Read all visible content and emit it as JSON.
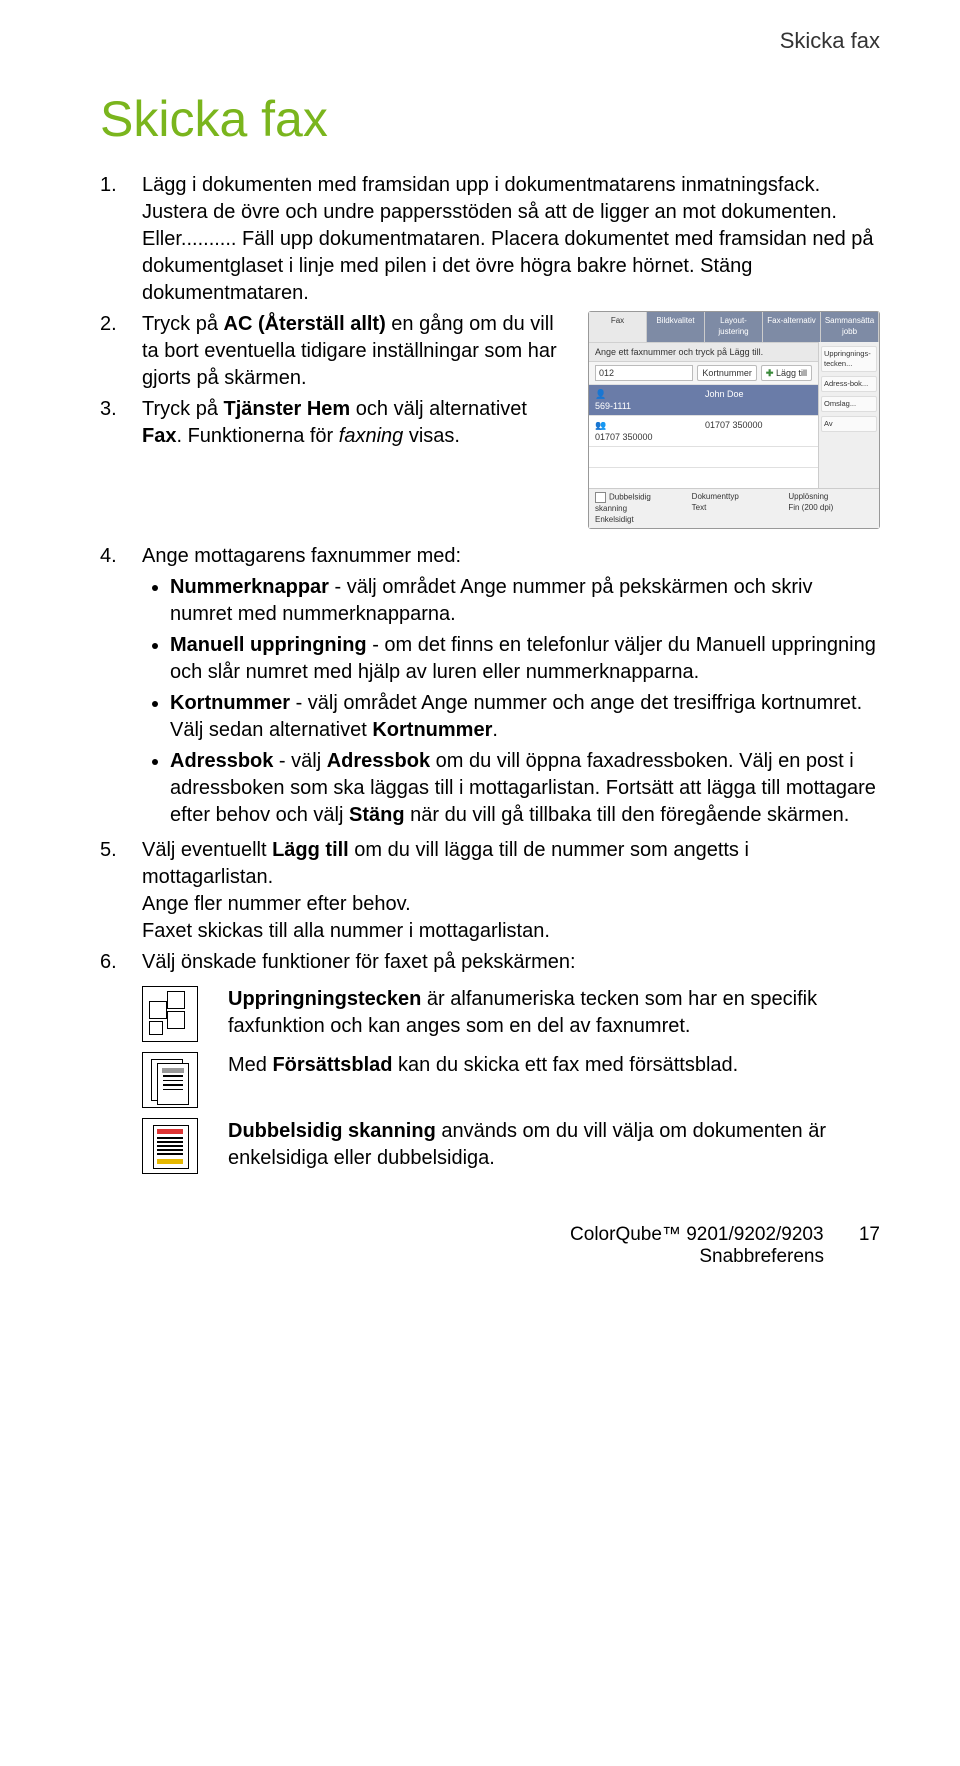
{
  "header": {
    "section": "Skicka fax"
  },
  "title": "Skicka fax",
  "steps": {
    "s1": "Lägg i dokumenten med framsidan upp i dokumentmatarens inmatningsfack. Justera de övre och undre pappersstöden så att de ligger an mot dokumenten. Eller.......... Fäll upp dokumentmataren. Placera dokumentet med framsidan ned på dokumentglaset i linje med pilen i det övre högra bakre hörnet. Stäng dokumentmataren.",
    "s2_a": "Tryck på ",
    "s2_b": "AC (Återställ allt)",
    "s2_c": " en gång om du vill ta bort eventuella tidigare inställningar som har gjorts på skärmen.",
    "s3_a": "Tryck på ",
    "s3_b": "Tjänster Hem",
    "s3_c": "  och välj alternativet ",
    "s3_d": "Fax",
    "s3_e": ". Funktionerna för ",
    "s3_f": "faxning",
    "s3_g": " visas.",
    "s4": "Ange mottagarens faxnummer med:",
    "b1_a": "Nummerknappar",
    "b1_b": " - välj området Ange nummer på pekskärmen och skriv numret med nummerknapparna.",
    "b2_a": "Manuell uppringning",
    "b2_b": " - om det finns en telefonlur väljer du Manuell uppringning och slår numret med hjälp av luren eller nummerknapparna.",
    "b3_a": "Kortnummer",
    "b3_b": " - välj området Ange nummer och ange det tresiffriga kortnumret. Välj sedan alternativet ",
    "b3_c": "Kortnummer",
    "b3_d": ".",
    "b4_a": "Adressbok",
    "b4_b": " - välj ",
    "b4_c": "Adressbok",
    "b4_d": " om du vill öppna faxadressboken. Välj en post i adressboken som ska läggas till i mottagarlistan. Fortsätt att lägga till mottagare efter behov och välj ",
    "b4_e": "Stäng",
    "b4_f": " när du vill gå tillbaka till den föregående skärmen.",
    "s5_a": "Välj eventuellt ",
    "s5_b": "Lägg till",
    "s5_c": " om du vill lägga till de nummer som angetts i mottagarlistan.",
    "s5_d": "Ange fler nummer efter behov.",
    "s5_e": "Faxet skickas till alla nummer i mottagarlistan.",
    "s6": "Välj önskade funktioner för faxet på pekskärmen:",
    "ic1_a": "Uppringningstecken",
    "ic1_b": " är alfanumeriska tecken som har en specifik faxfunktion och kan anges som en del av faxnumret.",
    "ic2_a": "Med ",
    "ic2_b": "Försättsblad",
    "ic2_c": " kan du skicka ett fax med försättsblad.",
    "ic3_a": "Dubbelsidig skanning",
    "ic3_b": " används om du vill välja om dokumenten är enkelsidiga eller dubbelsidiga."
  },
  "shot": {
    "tabs": [
      "Fax",
      "Bildkvalitet",
      "Layout-justering",
      "Fax-alternativ",
      "Sammansätta jobb"
    ],
    "instruction": "Ange ett faxnummer och tryck på Lägg till.",
    "input_val": "012",
    "kort": "Kortnummer",
    "lagg": "Lägg till",
    "rows": [
      {
        "num": "569-1111",
        "name": "John Doe"
      },
      {
        "num": "01707 350000",
        "name": "01707 350000"
      }
    ],
    "side": [
      "Uppringnings-tecken...",
      "Adress-bok...",
      "Omslag...",
      "Av"
    ],
    "bottom_left_chk": "Dubbelsidig skanning",
    "bottom_left": "Enkelsidigt",
    "bottom_mid_lbl": "Dokumenttyp",
    "bottom_mid": "Text",
    "bottom_right_lbl": "Upplösning",
    "bottom_right": "Fin (200 dpi)"
  },
  "footer": {
    "product": "ColorQube™ 9201/9202/9203",
    "doc": "Snabbreferens",
    "page": "17"
  }
}
